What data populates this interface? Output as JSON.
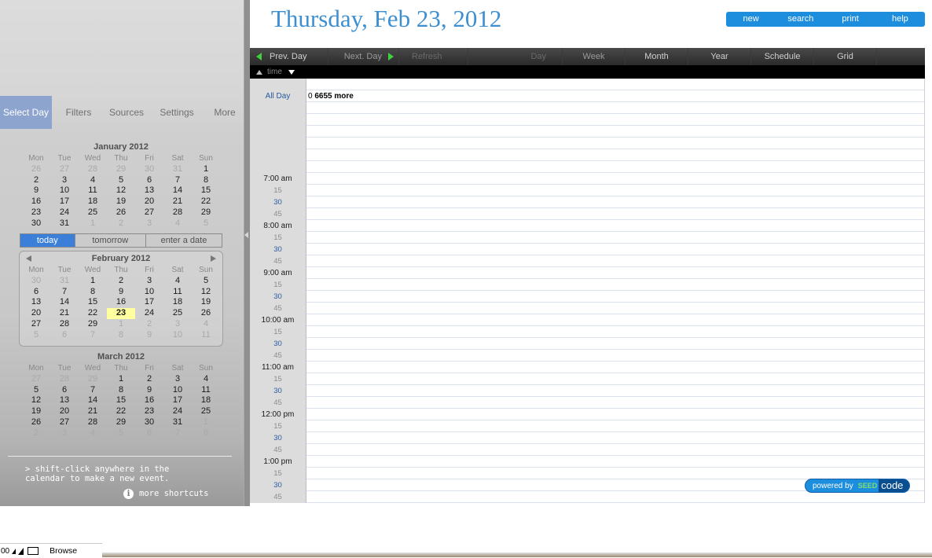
{
  "header": {
    "date_title": "Thursday, Feb 23, 2012",
    "actions": [
      "new",
      "search",
      "print",
      "help"
    ]
  },
  "sidebar": {
    "tabs": [
      "Select Day",
      "Filters",
      "Sources",
      "Settings",
      "More"
    ],
    "active_tab": "Select Day",
    "quick": [
      "today",
      "tomorrow",
      "enter a date"
    ],
    "dow": [
      "Mon",
      "Tue",
      "Wed",
      "Thu",
      "Fri",
      "Sat",
      "Sun"
    ],
    "calendars": [
      {
        "title": "January 2012",
        "weeks": [
          [
            [
              "26",
              1
            ],
            [
              "27",
              1
            ],
            [
              "28",
              1
            ],
            [
              "29",
              1
            ],
            [
              "30",
              1
            ],
            [
              "31",
              1
            ],
            [
              "1",
              0
            ]
          ],
          [
            [
              "2",
              0
            ],
            [
              "3",
              0
            ],
            [
              "4",
              0
            ],
            [
              "5",
              0
            ],
            [
              "6",
              0
            ],
            [
              "7",
              0
            ],
            [
              "8",
              0
            ]
          ],
          [
            [
              "9",
              0
            ],
            [
              "10",
              0
            ],
            [
              "11",
              0
            ],
            [
              "12",
              0
            ],
            [
              "13",
              0
            ],
            [
              "14",
              0
            ],
            [
              "15",
              0
            ]
          ],
          [
            [
              "16",
              0
            ],
            [
              "17",
              0
            ],
            [
              "18",
              0
            ],
            [
              "19",
              0
            ],
            [
              "20",
              0
            ],
            [
              "21",
              0
            ],
            [
              "22",
              0
            ]
          ],
          [
            [
              "23",
              0
            ],
            [
              "24",
              0
            ],
            [
              "25",
              0
            ],
            [
              "26",
              0
            ],
            [
              "27",
              0
            ],
            [
              "28",
              0
            ],
            [
              "29",
              0
            ]
          ],
          [
            [
              "30",
              0
            ],
            [
              "31",
              0
            ],
            [
              "1",
              1
            ],
            [
              "2",
              1
            ],
            [
              "3",
              1
            ],
            [
              "4",
              1
            ],
            [
              "5",
              1
            ]
          ]
        ]
      },
      {
        "title": "February 2012",
        "weeks": [
          [
            [
              "30",
              1
            ],
            [
              "31",
              1
            ],
            [
              "1",
              0
            ],
            [
              "2",
              0
            ],
            [
              "3",
              0
            ],
            [
              "4",
              0
            ],
            [
              "5",
              0
            ]
          ],
          [
            [
              "6",
              0
            ],
            [
              "7",
              0
            ],
            [
              "8",
              0
            ],
            [
              "9",
              0
            ],
            [
              "10",
              0
            ],
            [
              "11",
              0
            ],
            [
              "12",
              0
            ]
          ],
          [
            [
              "13",
              0
            ],
            [
              "14",
              0
            ],
            [
              "15",
              0
            ],
            [
              "16",
              0
            ],
            [
              "17",
              0
            ],
            [
              "18",
              0
            ],
            [
              "19",
              0
            ]
          ],
          [
            [
              "20",
              0
            ],
            [
              "21",
              0
            ],
            [
              "22",
              0
            ],
            [
              "23",
              2
            ],
            [
              "24",
              0
            ],
            [
              "25",
              0
            ],
            [
              "26",
              0
            ]
          ],
          [
            [
              "27",
              0
            ],
            [
              "28",
              0
            ],
            [
              "29",
              0
            ],
            [
              "1",
              1
            ],
            [
              "2",
              1
            ],
            [
              "3",
              1
            ],
            [
              "4",
              1
            ]
          ],
          [
            [
              "5",
              1
            ],
            [
              "6",
              1
            ],
            [
              "7",
              1
            ],
            [
              "8",
              1
            ],
            [
              "9",
              1
            ],
            [
              "10",
              1
            ],
            [
              "11",
              1
            ]
          ]
        ]
      },
      {
        "title": "March 2012",
        "weeks": [
          [
            [
              "27",
              1
            ],
            [
              "28",
              1
            ],
            [
              "29",
              1
            ],
            [
              "1",
              0
            ],
            [
              "2",
              0
            ],
            [
              "3",
              0
            ],
            [
              "4",
              0
            ]
          ],
          [
            [
              "5",
              0
            ],
            [
              "6",
              0
            ],
            [
              "7",
              0
            ],
            [
              "8",
              0
            ],
            [
              "9",
              0
            ],
            [
              "10",
              0
            ],
            [
              "11",
              0
            ]
          ],
          [
            [
              "12",
              0
            ],
            [
              "13",
              0
            ],
            [
              "14",
              0
            ],
            [
              "15",
              0
            ],
            [
              "16",
              0
            ],
            [
              "17",
              0
            ],
            [
              "18",
              0
            ]
          ],
          [
            [
              "19",
              0
            ],
            [
              "20",
              0
            ],
            [
              "21",
              0
            ],
            [
              "22",
              0
            ],
            [
              "23",
              0
            ],
            [
              "24",
              0
            ],
            [
              "25",
              0
            ]
          ],
          [
            [
              "26",
              0
            ],
            [
              "27",
              0
            ],
            [
              "28",
              0
            ],
            [
              "29",
              0
            ],
            [
              "30",
              0
            ],
            [
              "31",
              0
            ],
            [
              "1",
              1
            ]
          ],
          [
            [
              "2",
              1
            ],
            [
              "3",
              1
            ],
            [
              "4",
              1
            ],
            [
              "5",
              1
            ],
            [
              "6",
              1
            ],
            [
              "7",
              1
            ],
            [
              "8",
              1
            ]
          ]
        ]
      }
    ],
    "hint": "> shift-click anywhere in the\ncalendar to make a new event.",
    "shortcuts_label": "more shortcuts",
    "info_glyph": "i"
  },
  "nav": {
    "prev": "Prev. Day",
    "next": "Next. Day",
    "refresh": "Refresh",
    "views": [
      "Day",
      "Week",
      "Month",
      "Year",
      "Schedule",
      "Grid"
    ],
    "time_label": "time"
  },
  "dayview": {
    "allday_label": "All Day",
    "allday_count": "0",
    "allday_more": "6655 more",
    "times": [
      {
        "label": "7:00 am",
        "kind": "hour"
      },
      {
        "label": "15",
        "kind": "q"
      },
      {
        "label": "30",
        "kind": "half"
      },
      {
        "label": "45",
        "kind": "q"
      },
      {
        "label": "8:00 am",
        "kind": "hour"
      },
      {
        "label": "15",
        "kind": "q"
      },
      {
        "label": "30",
        "kind": "half"
      },
      {
        "label": "45",
        "kind": "q"
      },
      {
        "label": "9:00 am",
        "kind": "hour"
      },
      {
        "label": "15",
        "kind": "q"
      },
      {
        "label": "30",
        "kind": "half"
      },
      {
        "label": "45",
        "kind": "q"
      },
      {
        "label": "10:00 am",
        "kind": "hour"
      },
      {
        "label": "15",
        "kind": "q"
      },
      {
        "label": "30",
        "kind": "half"
      },
      {
        "label": "45",
        "kind": "q"
      },
      {
        "label": "11:00 am",
        "kind": "hour"
      },
      {
        "label": "15",
        "kind": "q"
      },
      {
        "label": "30",
        "kind": "half"
      },
      {
        "label": "45",
        "kind": "q"
      },
      {
        "label": "12:00 pm",
        "kind": "hour"
      },
      {
        "label": "15",
        "kind": "q"
      },
      {
        "label": "30",
        "kind": "half"
      },
      {
        "label": "45",
        "kind": "q"
      },
      {
        "label": "1:00 pm",
        "kind": "hour"
      },
      {
        "label": "15",
        "kind": "q"
      },
      {
        "label": "30",
        "kind": "half"
      },
      {
        "label": "45",
        "kind": "q"
      }
    ]
  },
  "branding": {
    "powered_by": "powered by",
    "seed": "SEED",
    "code": "code"
  },
  "status": {
    "zoom": "00",
    "mode": "Browse"
  },
  "colors": {
    "accent": "#1d8ddd",
    "title_blue": "#3d8fd0",
    "active_tab": "#8da4cf",
    "today_highlight": "#ffffa0",
    "nav_green": "#3fcf3f"
  }
}
